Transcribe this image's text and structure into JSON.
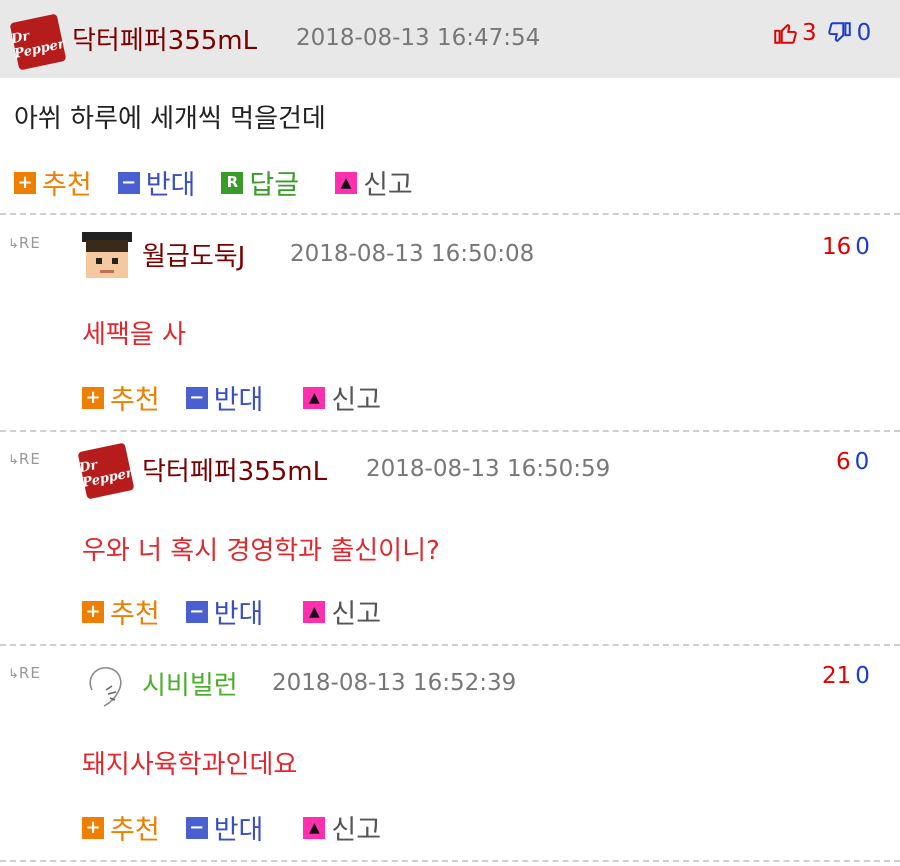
{
  "top": {
    "nickname": "닥터페퍼355mL",
    "date": "2018-08-13 16:47:54",
    "up_count": "3",
    "down_count": "0",
    "text": "아쒸 하루에 세개씩 먹을건데",
    "avatar_label": "Dr Pepper",
    "actions": {
      "recommend": "추천",
      "oppose": "반대",
      "reply": "답글",
      "report": "신고"
    }
  },
  "replies": [
    {
      "nickname": "월급도둑J",
      "date": "2018-08-13 16:50:08",
      "up_count": "16",
      "down_count": "0",
      "text": "세팩을 사",
      "actions": {
        "recommend": "추천",
        "oppose": "반대",
        "report": "신고"
      }
    },
    {
      "nickname": "닥터페퍼355mL",
      "date": "2018-08-13 16:50:59",
      "up_count": "6",
      "down_count": "0",
      "text": "우와 너 혹시 경영학과 출신이니?",
      "avatar_label": "Dr Pepper",
      "actions": {
        "recommend": "추천",
        "oppose": "반대",
        "report": "신고"
      }
    },
    {
      "nickname": "시비빌런",
      "date": "2018-08-13 16:52:39",
      "up_count": "21",
      "down_count": "0",
      "text": "돼지사육학과인데요",
      "actions": {
        "recommend": "추천",
        "oppose": "반대",
        "report": "신고"
      }
    }
  ],
  "re_label": "RE",
  "icons": {
    "thumbs_up": "thumbs-up-icon",
    "thumbs_down": "thumbs-down-icon",
    "plus": "plus-icon",
    "minus": "minus-icon",
    "reply": "reply-icon",
    "siren": "siren-icon",
    "reply_arrow": "reply-arrow-icon"
  },
  "colors": {
    "recommend": "#ef7f00",
    "oppose": "#4a5fd0",
    "reply": "#3a9a2a",
    "report_icon": "#ff2fb0",
    "up": "#e00000",
    "down": "#1a3ad6",
    "reply_text": "#e0282e"
  }
}
